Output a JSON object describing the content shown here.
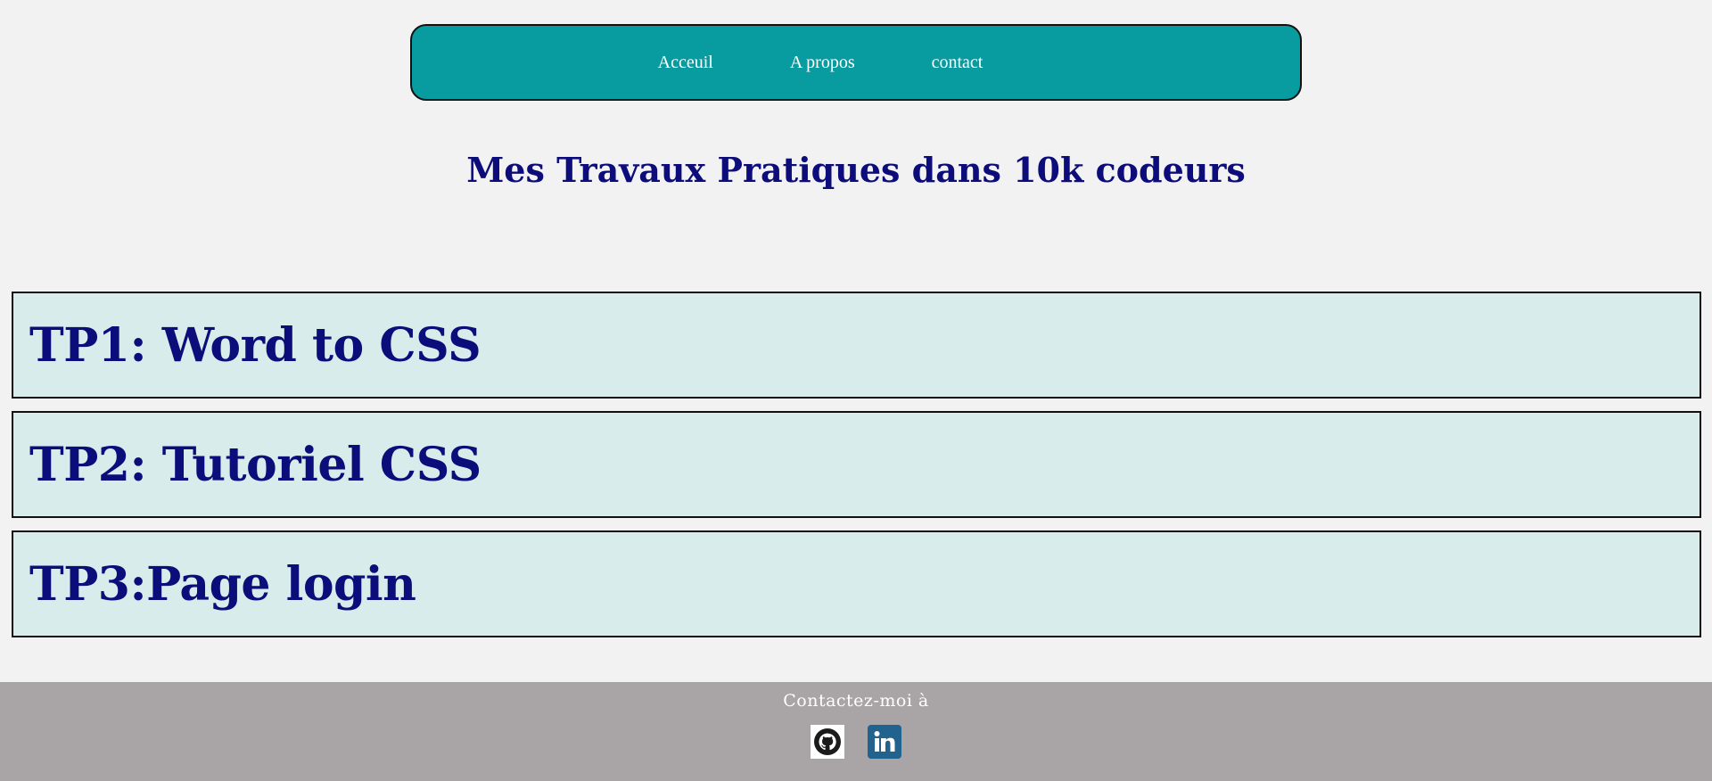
{
  "nav": {
    "items": [
      {
        "label": "Acceuil"
      },
      {
        "label": "A propos"
      },
      {
        "label": "contact"
      }
    ]
  },
  "main": {
    "title": "Mes Travaux Pratiques dans 10k codeurs",
    "tps": [
      {
        "label": "TP1: Word to CSS"
      },
      {
        "label": "TP2: Tutoriel CSS"
      },
      {
        "label": "TP3:Page login"
      }
    ]
  },
  "footer": {
    "contact_text": "Contactez-moi à",
    "icons": [
      "github-icon",
      "linkedin-icon"
    ]
  },
  "colors": {
    "navbar": "#089b9f",
    "title": "#0c0c7a",
    "card_bg": "#d8ecec",
    "footer_bg": "#a9a4a5",
    "page_bg": "#f3f2f3"
  }
}
